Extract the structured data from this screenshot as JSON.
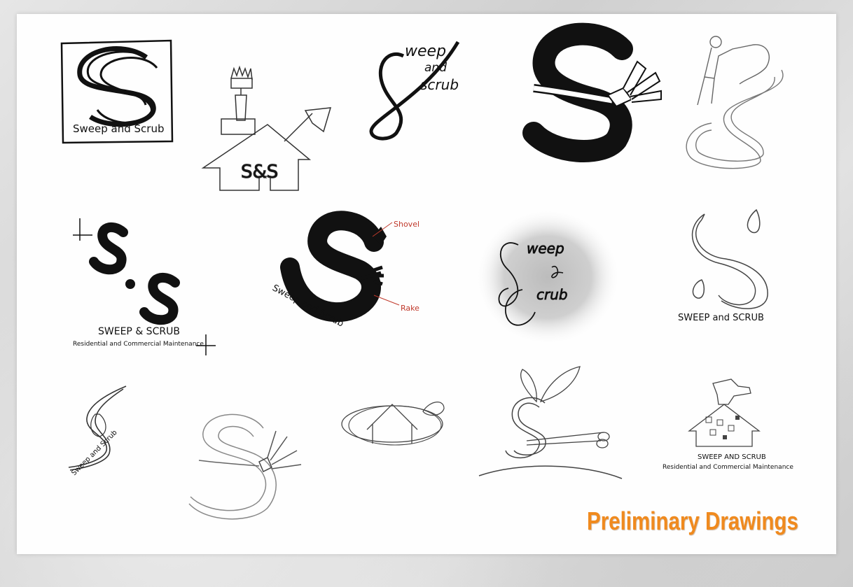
{
  "page": {
    "title": "Preliminary Drawings",
    "accent_color": "#f08a1e",
    "ink_color": "#111111",
    "paper_color": "#fefefe"
  },
  "sketches": [
    {
      "id": "boxed-swirl-s",
      "text": "Sweep and Scrub"
    },
    {
      "id": "house-shovel",
      "text": "S&S"
    },
    {
      "id": "script-s",
      "line1": "weep",
      "line2": "and",
      "line3": "scrub"
    },
    {
      "id": "bold-s-broom"
    },
    {
      "id": "worker-s"
    },
    {
      "id": "s-dot-s",
      "text": "SWEEP & SCRUB",
      "sub": "Residential and Commercial Maintenance"
    },
    {
      "id": "s-shovel-rake",
      "callout1": "Shovel",
      "callout2": "Rake",
      "text": "Sweep and Scrub"
    },
    {
      "id": "smudge-script",
      "line1": "weep",
      "line2": "crub"
    },
    {
      "id": "flame-s",
      "text": "SWEEP and SCRUB"
    },
    {
      "id": "leaf-swirl",
      "text": "Sweep and Scrub"
    },
    {
      "id": "outline-s-broom"
    },
    {
      "id": "house-leaf-oval"
    },
    {
      "id": "sprout-scissors-s"
    },
    {
      "id": "spray-house",
      "text": "SWEEP AND SCRUB",
      "sub": "Residential and Commercial Maintenance"
    }
  ]
}
